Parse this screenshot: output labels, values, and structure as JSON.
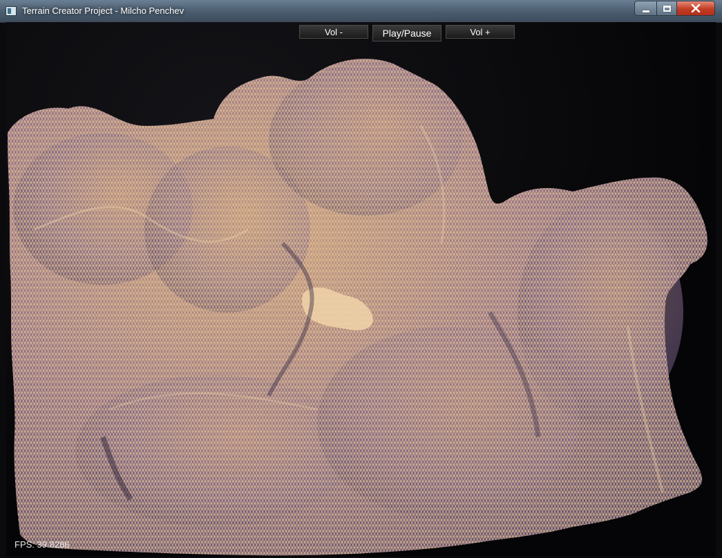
{
  "window": {
    "title": "Terrain Creator Project - Milcho Penchev"
  },
  "controls": {
    "vol_minus": "Vol -",
    "play_pause": "Play/Pause",
    "vol_plus": "Vol +"
  },
  "hud": {
    "fps_label": "FPS:",
    "fps_value": "39.8286"
  },
  "colors": {
    "terrain_light": "#d9b183",
    "terrain_shadow": "#8a6b8c",
    "wire": "#e8c79c",
    "background": "#050507"
  }
}
